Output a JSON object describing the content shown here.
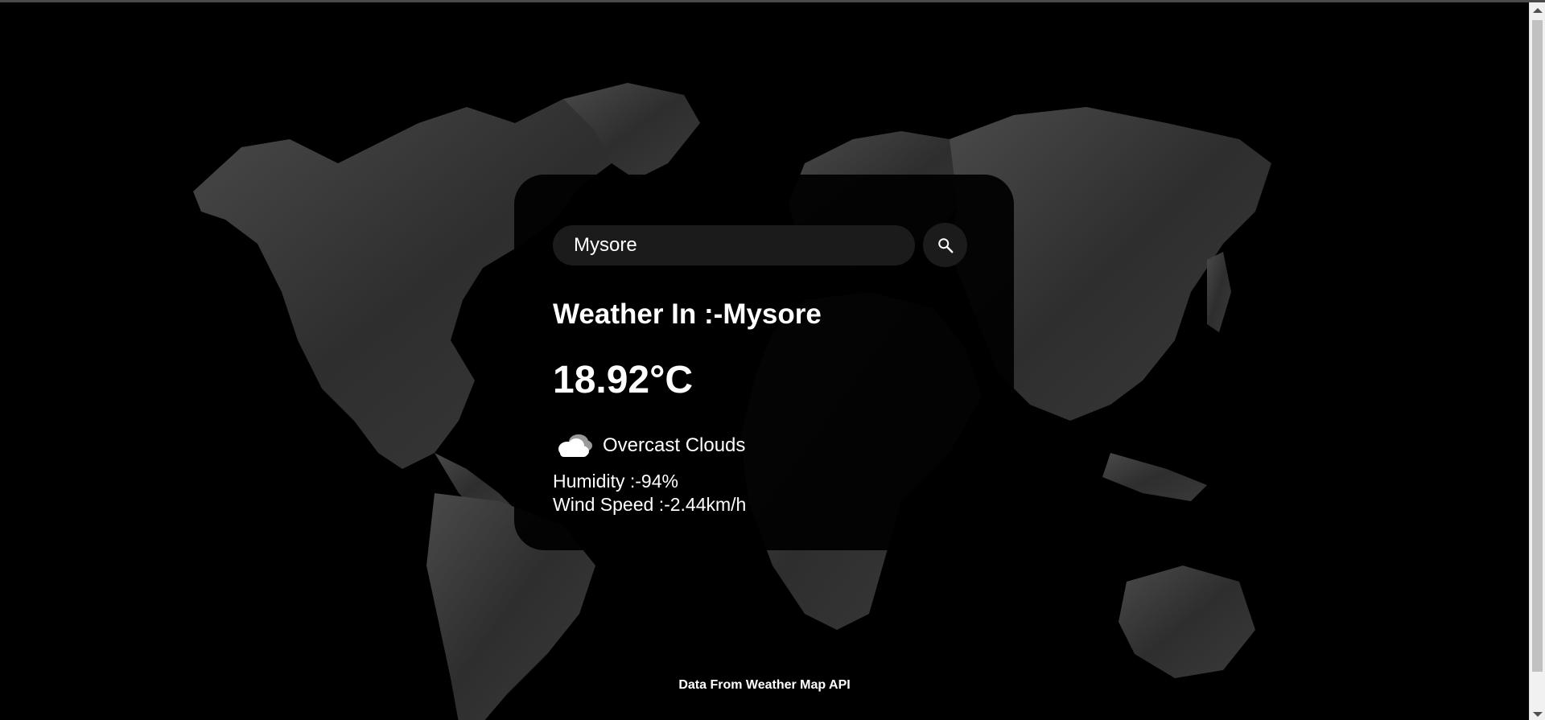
{
  "search": {
    "value": "Mysore",
    "icon": "search-icon"
  },
  "weather": {
    "title": "Weather In :-Mysore",
    "temperature": "18.92°C",
    "description": "Overcast Clouds",
    "icon": "overcast-clouds-icon",
    "humidity": "Humidity :-94%",
    "wind_speed": "Wind Speed :-2.44km/h"
  },
  "footer": {
    "text": "Data From Weather Map API"
  },
  "colors": {
    "background": "#000000",
    "card": "#050505",
    "input": "#1b1b1b",
    "text": "#ffffff",
    "map": "#3a3a3a"
  }
}
